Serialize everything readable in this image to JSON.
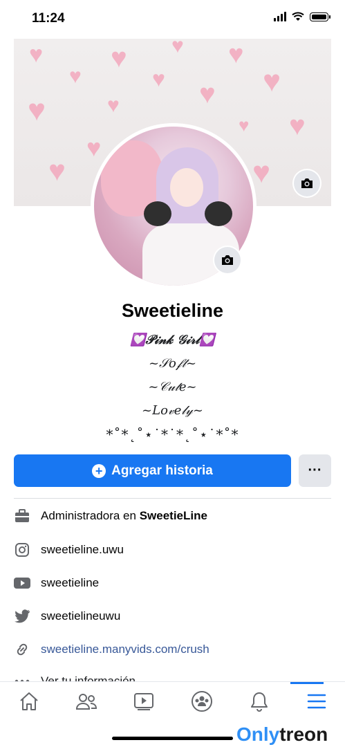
{
  "status_bar": {
    "time": "11:24"
  },
  "profile": {
    "name": "Sweetieline",
    "bio_lines": [
      "💟𝒫𝒾𝓃𝓀 𝒢𝒾𝓇𝓁💟",
      "~𝒮𝑜𝒻𝓉~",
      "~𝒞𝓊𝓉𝑒~",
      "~𝐿𝑜𝓋𝑒𝓁𝓎~",
      "*˚*˛˚⋆˙*˙*˛˚⋆˙*˚*"
    ]
  },
  "actions": {
    "add_story_label": "Agregar historia",
    "more_label": "···"
  },
  "info": {
    "work_prefix": "Administradora en ",
    "work_org": "SweetieLine",
    "instagram": "sweetieline.uwu",
    "youtube": "sweetieline",
    "twitter": "sweetielineuwu",
    "website": "sweetieline.manyvids.com/crush",
    "see_info": "Ver tu información"
  },
  "nav": {
    "tabs": [
      "home-icon",
      "friends-icon",
      "watch-icon",
      "groups-icon",
      "notifications-icon",
      "menu-icon"
    ],
    "active_tab": "menu-icon"
  },
  "watermark": {
    "part1": "Only",
    "part2": "treon"
  },
  "colors": {
    "accent": "#1877f2",
    "link": "#385898",
    "heart": "#f3a8bd"
  }
}
